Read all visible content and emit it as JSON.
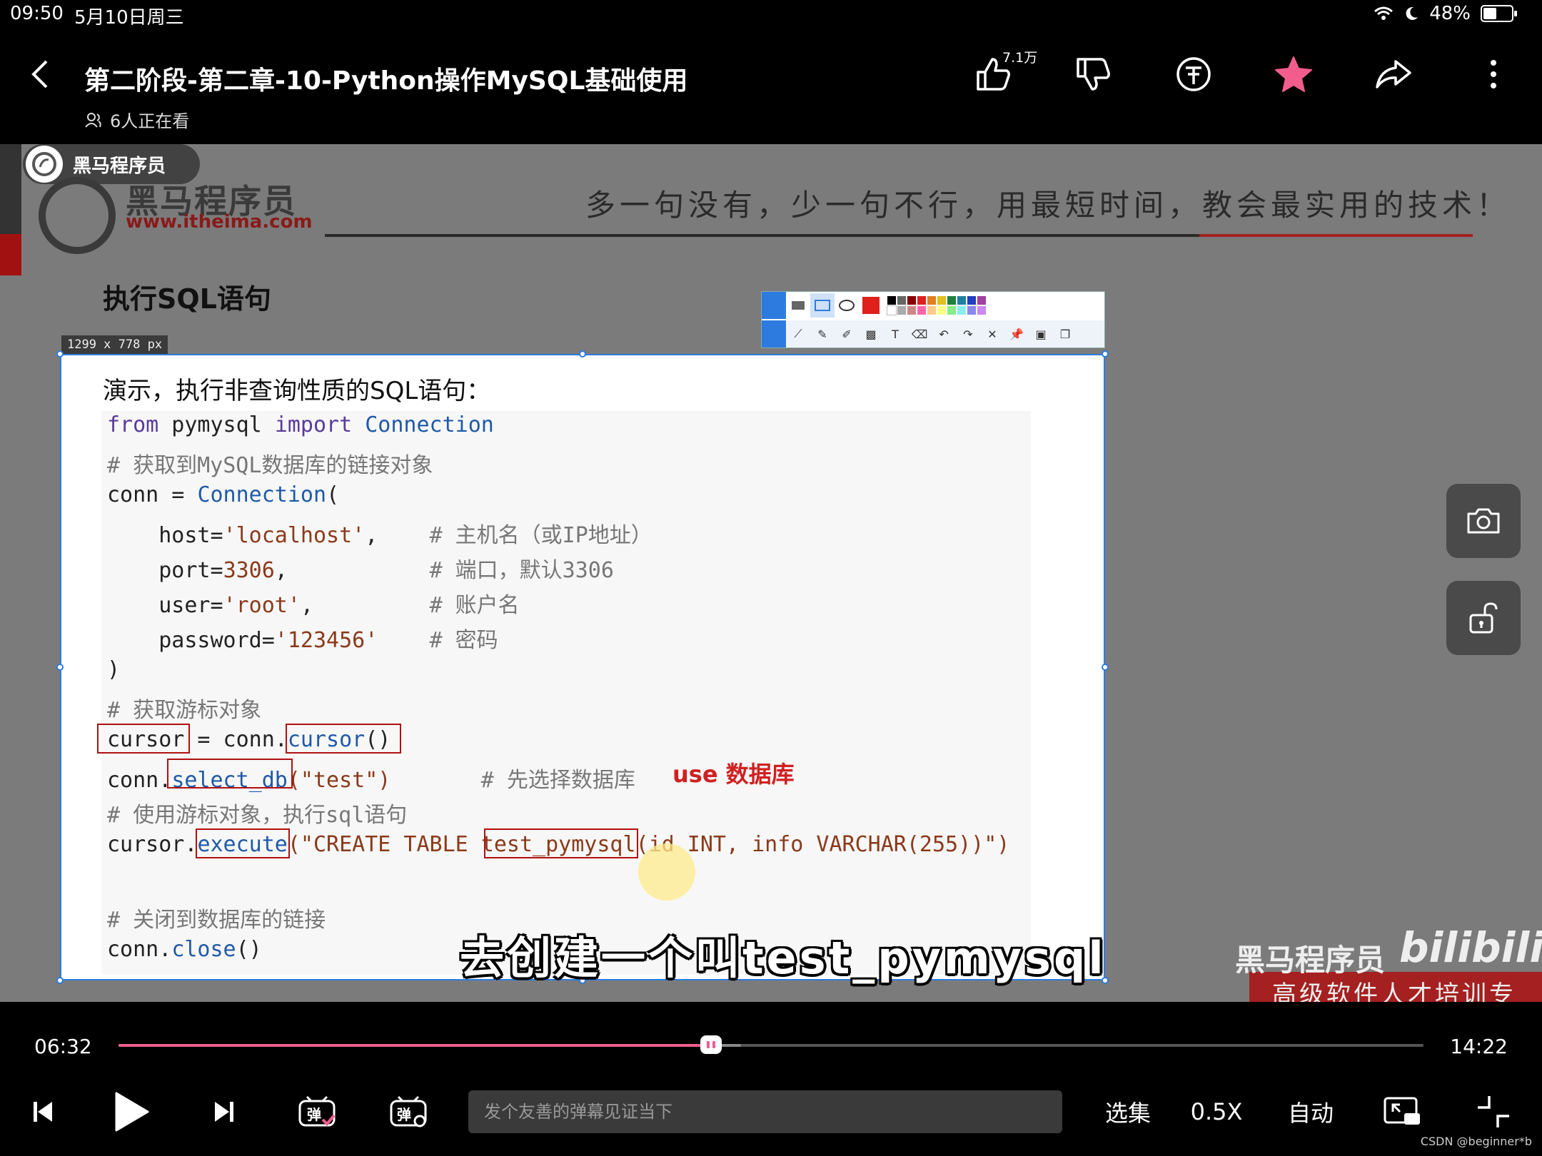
{
  "status_bar": {
    "time": "09:50",
    "date": "5月10日周三",
    "battery": "48%",
    "wifi_icon": "wifi-icon",
    "moon_icon": "moon-icon"
  },
  "header": {
    "title": "第二阶段-第二章-10-Python操作MySQL基础使用",
    "watching": "6人正在看",
    "like_count": "7.1万"
  },
  "video": {
    "channel_chip": "黑马程序员",
    "logo_cn": "黑马程序员",
    "logo_url": "www.itheima.com",
    "slogan": "多一句没有，少一句不行，用最短时间，教会最实用的技术！",
    "section_title": "执行SQL语句",
    "dims_label": "1299 x 778  px",
    "demo_title": "演示，执行非查询性质的SQL语句：",
    "code": {
      "l1": [
        "from",
        " pymysql ",
        "import",
        " Connection"
      ],
      "l2": "# 获取到MySQL数据库的链接对象",
      "l3": [
        "conn = ",
        "Connection",
        "("
      ],
      "l4": [
        "    host=",
        "'localhost'",
        ",    ",
        "# 主机名（或IP地址）"
      ],
      "l5": [
        "    port=",
        "3306",
        ",           ",
        "# 端口，默认3306"
      ],
      "l6": [
        "    user=",
        "'root'",
        ",         ",
        "# 账户名"
      ],
      "l7": [
        "    password=",
        "'123456'",
        "    ",
        "# 密码"
      ],
      "l8": ")",
      "l9": "# 获取游标对象",
      "l10": [
        "cursor",
        " = conn.",
        "cursor",
        "()"
      ],
      "l11": [
        "conn.",
        "select_db",
        "(\"test\")",
        "       # 先选择数据库"
      ],
      "l12": "# 使用游标对象，执行sql语句",
      "l13": [
        "cursor.",
        "execute",
        "(\"CREATE TABLE ",
        "test_pymysql",
        "(id INT, info VARCHAR(255))\")"
      ],
      "l14": "# 关闭到数据库的链接",
      "l15": [
        "conn.",
        "close",
        "()"
      ]
    },
    "annotation": "use 数据库",
    "subtitle": "去创建一个叫test_pymysql",
    "watermark_cn": "黑马程序员",
    "watermark_bili": "bilibili",
    "watermark_slogan": "高级软件人才培训专家"
  },
  "player": {
    "current_time": "06:32",
    "total_time": "14:22",
    "progress": 0.454,
    "buffered": 0.477,
    "danmaku_placeholder": "发个友善的弹幕见证当下",
    "episodes_label": "选集",
    "speed_label": "0.5X",
    "quality_label": "自动"
  },
  "credit": "CSDN @beginner*b",
  "colors": {
    "accent_pink": "#f25d8e",
    "favorite": "#f25d8e",
    "selection_blue": "#2e7be0",
    "annotation_red": "#d02020"
  }
}
